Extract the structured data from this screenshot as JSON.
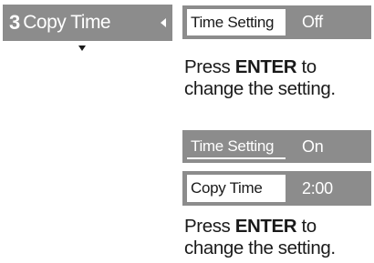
{
  "menu": {
    "number": "3",
    "label": "Copy Time"
  },
  "setting_off": {
    "label": "Time Setting",
    "value": "Off"
  },
  "instruction_1": {
    "prefix": "Press ",
    "key": "ENTER",
    "suffix": " to change the setting."
  },
  "setting_on": {
    "label": "Time Setting",
    "value": "On"
  },
  "copy_time": {
    "label": "Copy Time",
    "value": "2:00"
  },
  "instruction_2": {
    "prefix": "Press ",
    "key": "ENTER",
    "suffix": " to change the setting."
  },
  "colors": {
    "panel": "#8c8c8c",
    "text": "#1a1a1a",
    "highlight": "#ffffff"
  },
  "icons": [
    "arrow-left-icon",
    "arrow-down-icon"
  ]
}
